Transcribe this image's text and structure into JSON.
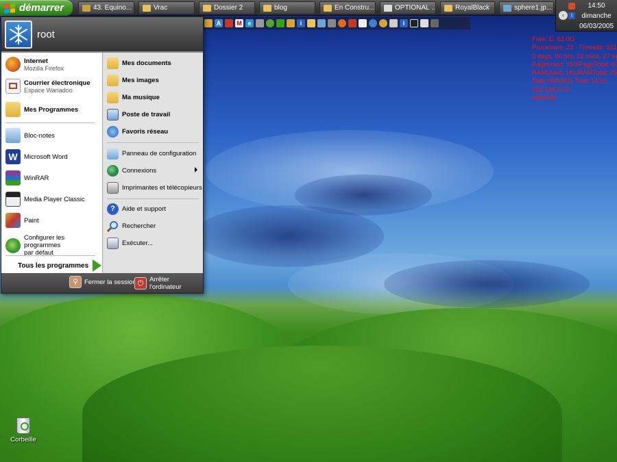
{
  "taskbar": {
    "start_label": "démarrer",
    "buttons": [
      {
        "label": "43. Equino...",
        "icon": "folder-icon",
        "color": "#c9a23a"
      },
      {
        "label": "Vrac",
        "icon": "folder-icon",
        "color": "#e8c35a"
      },
      {
        "label": "Dossier 2",
        "icon": "folder-icon",
        "color": "#e8c35a"
      },
      {
        "label": "blog",
        "icon": "folder-icon",
        "color": "#e8c35a"
      },
      {
        "label": "En Constru...",
        "icon": "folder-icon",
        "color": "#e8c35a"
      },
      {
        "label": "OPTIONAL ...",
        "icon": "browser-icon",
        "color": "#dddddd"
      },
      {
        "label": "RoyalBlack",
        "icon": "folder-icon",
        "color": "#e8c35a"
      },
      {
        "label": "sphere1.jp...",
        "icon": "image-icon",
        "color": "#6fa6d8"
      }
    ]
  },
  "tray": {
    "time": "14:50",
    "day": "dimanche",
    "date": "06/03/2005"
  },
  "sysinfo": [
    "Free: E: 62.0G",
    "Processes: 23 · Threads: 311",
    "0 days, 00 hrs, 22 mins, 27 secs",
    "PageUsed: 150/PageTotal: 619",
    "RAMUsed: 141/RAMTotal: 255",
    "Date 06/03/05 Time 14:50",
    "192.168.0.10",
    "ARIANE"
  ],
  "startmenu": {
    "username": "root",
    "left": {
      "pinned": [
        {
          "title": "Internet",
          "subtitle": "Mozilla Firefox",
          "icon": "firefox-icon",
          "color": "#e06a1b"
        },
        {
          "title": "Courrier électronique",
          "subtitle": "Espace Wanadoo",
          "icon": "mail-icon",
          "color": "#c0392b"
        },
        {
          "title": "Mes Programmes",
          "subtitle": "",
          "icon": "folder-icon",
          "color": "#e8c35a"
        }
      ],
      "recent": [
        {
          "label": "Bloc-notes",
          "icon": "notepad-icon",
          "color": "#6fa6d8"
        },
        {
          "label": "Microsoft Word",
          "icon": "word-icon",
          "color": "#1f3f9a"
        },
        {
          "label": "WinRAR",
          "icon": "winrar-icon",
          "color": "#8b3aa0"
        },
        {
          "label": "Media Player Classic",
          "icon": "media-player-icon",
          "color": "#444444"
        },
        {
          "label": "Paint",
          "icon": "paint-icon",
          "color": "#d9a23a"
        },
        {
          "label": "Configurer les programmes",
          "label2": "par défaut",
          "icon": "defaults-icon",
          "color": "#3a9f1a"
        }
      ],
      "all_programs": "Tous les programmes"
    },
    "right": {
      "places": [
        {
          "label": "Mes documents",
          "icon": "documents-icon",
          "color": "#e8c35a"
        },
        {
          "label": "Mes images",
          "icon": "pictures-icon",
          "color": "#e8c35a"
        },
        {
          "label": "Ma musique",
          "icon": "music-icon",
          "color": "#e8c35a"
        },
        {
          "label": "Poste de travail",
          "icon": "computer-icon",
          "color": "#6fa6d8"
        },
        {
          "label": "Favoris réseau",
          "icon": "network-icon",
          "color": "#3d7fd0"
        }
      ],
      "system": [
        {
          "label": "Panneau de configuration",
          "icon": "control-panel-icon",
          "color": "#6fa6d8"
        },
        {
          "label": "Connexions",
          "icon": "connections-icon",
          "color": "#2a8f3a"
        },
        {
          "label": "Imprimantes et télécopieurs",
          "icon": "printer-icon",
          "color": "#999999"
        }
      ],
      "help": [
        {
          "label": "Aide et support",
          "icon": "help-icon",
          "color": "#2a5fc0"
        },
        {
          "label": "Rechercher",
          "icon": "search-icon",
          "color": "#6fa6d8"
        },
        {
          "label": "Exécuter...",
          "icon": "run-icon",
          "color": "#9aa8b8"
        }
      ]
    },
    "footer": {
      "logoff": "Fermer la session",
      "shutdown": "Arrêter l'ordinateur"
    }
  },
  "desktop": {
    "recycle_label": "Corbeille"
  }
}
